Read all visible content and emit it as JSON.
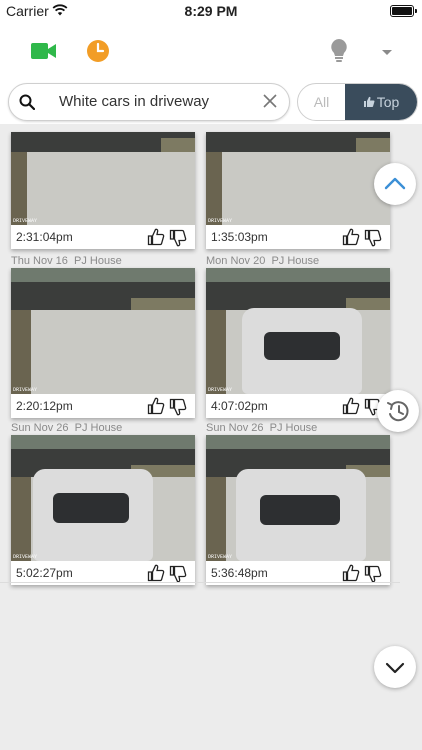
{
  "status": {
    "carrier": "Carrier",
    "time": "8:29 PM"
  },
  "toolbar": {
    "camera_icon": "video-camera-icon",
    "clock_icon": "clock-icon",
    "bulb_icon": "lightbulb-icon",
    "dropdown_icon": "chevron-down-icon",
    "colors": {
      "green": "#2fb84a",
      "orange": "#f29d26",
      "gray": "#9a9a9a"
    }
  },
  "search": {
    "query": "White cars in driveway"
  },
  "filter": {
    "all_label": "All",
    "top_label": "Top"
  },
  "clips": [
    {
      "date": "",
      "place": "",
      "time": "2:31:04pm",
      "car": false
    },
    {
      "date": "",
      "place": "",
      "time": "1:35:03pm",
      "car": false
    },
    {
      "date": "Thu Nov 16",
      "place": "PJ House",
      "time": "2:20:12pm",
      "car": false
    },
    {
      "date": "Mon Nov 20",
      "place": "PJ House",
      "time": "4:07:02pm",
      "car": true
    },
    {
      "date": "Sun Nov 26",
      "place": "PJ House",
      "time": "5:02:27pm",
      "car": true
    },
    {
      "date": "Sun Nov 26",
      "place": "PJ House",
      "time": "5:36:48pm",
      "car": true
    }
  ],
  "image_overlay": {
    "camera_label": "DRIVEWAY"
  },
  "fab": {
    "scroll_up_icon": "chevron-up-icon",
    "history_icon": "history-icon",
    "scroll_down_icon": "chevron-down-icon"
  }
}
